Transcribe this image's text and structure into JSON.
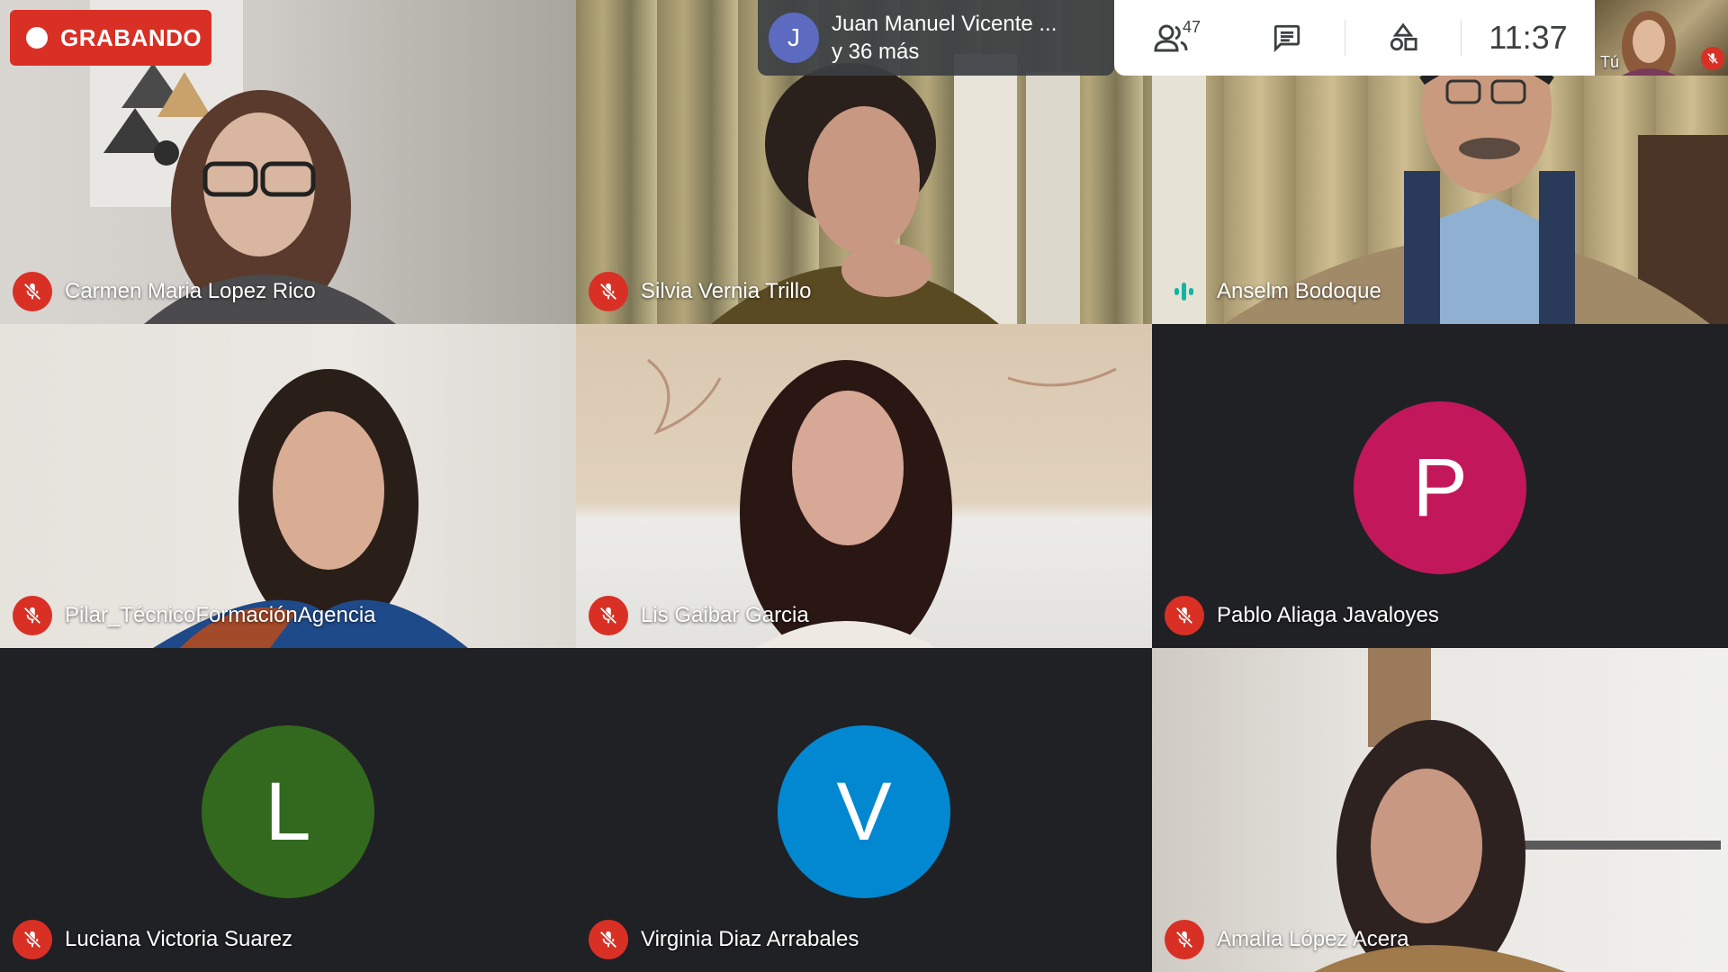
{
  "recording": {
    "label": "GRABANDO"
  },
  "presenter": {
    "initial": "J",
    "line1": "Juan Manuel Vicente ...",
    "line2": "y 36 más"
  },
  "toolbar": {
    "people_count": "47",
    "time": "11:37"
  },
  "self_view": {
    "label": "Tú"
  },
  "colors": {
    "mute_red": "#d93025",
    "avatar_p": "#c2185b",
    "avatar_l": "#33691e",
    "avatar_v": "#0288d1",
    "presenter_avatar": "#5c6bc0",
    "speaking_teal": "#12b5a5"
  },
  "participants": [
    {
      "name": "Carmen Maria Lopez Rico",
      "muted": true,
      "video": true
    },
    {
      "name": "Silvia Vernia Trillo",
      "muted": true,
      "video": true
    },
    {
      "name": "Anselm Bodoque",
      "muted": false,
      "speaking": true,
      "video": true
    },
    {
      "name": "Pilar_TécnicoFormaciónAgencia",
      "muted": true,
      "video": true
    },
    {
      "name": "Lis Gaibar Garcia",
      "muted": true,
      "video": true
    },
    {
      "name": "Pablo Aliaga Javaloyes",
      "muted": true,
      "video": false,
      "initial": "P"
    },
    {
      "name": "Luciana Victoria Suarez",
      "muted": true,
      "video": false,
      "initial": "L"
    },
    {
      "name": "Virginia Diaz Arrabales",
      "muted": true,
      "video": false,
      "initial": "V"
    },
    {
      "name": "Amalia López Acera",
      "muted": true,
      "video": true
    }
  ]
}
